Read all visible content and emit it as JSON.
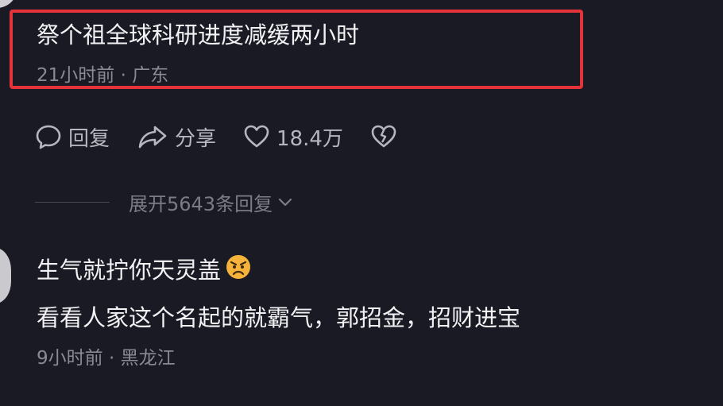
{
  "comment1": {
    "text": "祭个祖全球科研进度减缓两小时",
    "meta": "21小时前 · 广东"
  },
  "actions": {
    "reply_label": "回复",
    "share_label": "分享",
    "like_count": "18.4万"
  },
  "expand": {
    "label": "展开5643条回复"
  },
  "comment2": {
    "line1": "生气就拧你天灵盖",
    "emoji": "angry-face-icon",
    "line2": "看看人家这个名起的就霸气，郭招金，招财进宝",
    "meta": "9小时前 · 黑龙江"
  },
  "colors": {
    "background": "#1a1a24",
    "highlight": "#e5333a",
    "text": "#f2f2f4",
    "meta": "#8a8a94"
  }
}
